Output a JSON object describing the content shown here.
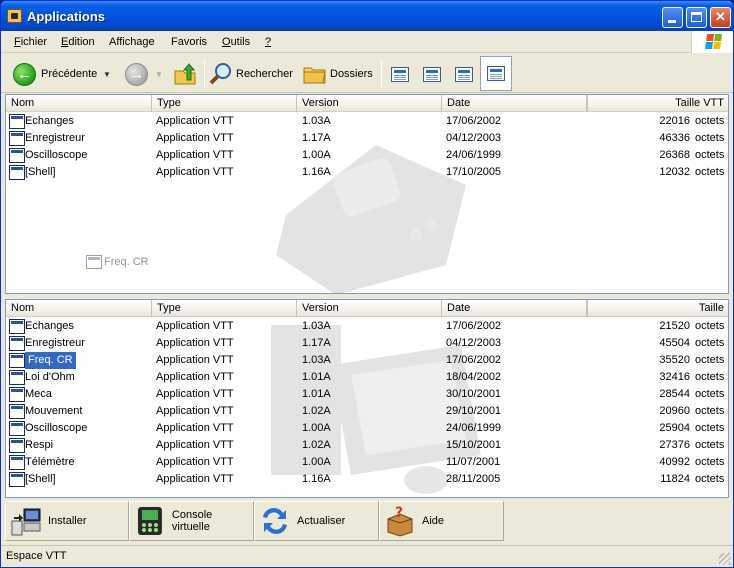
{
  "window": {
    "title": "Applications"
  },
  "menu": [
    {
      "mnemonic": "F",
      "rest": "ichier"
    },
    {
      "mnemonic": "E",
      "rest": "dition"
    },
    {
      "mnemonic": "",
      "rest": "Affichage"
    },
    {
      "mnemonic": "",
      "rest": "Favoris"
    },
    {
      "mnemonic": "O",
      "rest": "utils"
    },
    {
      "mnemonic": "?",
      "rest": ""
    }
  ],
  "menu_full": [
    "Fichier",
    "Edition",
    "Affichage",
    "Favoris",
    "Outils",
    "?"
  ],
  "toolbar": {
    "back_label": "Précédente",
    "search_label": "Rechercher",
    "folders_label": "Dossiers"
  },
  "top_pane": {
    "columns": [
      "Nom",
      "Type",
      "Version",
      "Date",
      "Taille VTT"
    ],
    "rows": [
      {
        "name": "Echanges",
        "type": "Application VTT",
        "version": "1.03A",
        "date": "17/06/2002",
        "size": "22016",
        "unit": "octets"
      },
      {
        "name": "Enregistreur",
        "type": "Application VTT",
        "version": "1.17A",
        "date": "04/12/2003",
        "size": "46336",
        "unit": "octets"
      },
      {
        "name": "Oscilloscope",
        "type": "Application VTT",
        "version": "1.00A",
        "date": "24/06/1999",
        "size": "26368",
        "unit": "octets"
      },
      {
        "name": "[Shell]",
        "type": "Application VTT",
        "version": "1.16A",
        "date": "17/10/2005",
        "size": "12032",
        "unit": "octets"
      }
    ],
    "drag_ghost_label": "Freq. CR"
  },
  "bottom_pane": {
    "columns": [
      "Nom",
      "Type",
      "Version",
      "Date",
      "Taille"
    ],
    "rows": [
      {
        "name": "Echanges",
        "type": "Application VTT",
        "version": "1.03A",
        "date": "17/06/2002",
        "size": "21520",
        "unit": "octets"
      },
      {
        "name": "Enregistreur",
        "type": "Application VTT",
        "version": "1.17A",
        "date": "04/12/2003",
        "size": "45504",
        "unit": "octets"
      },
      {
        "name": "Freq. CR",
        "type": "Application VTT",
        "version": "1.03A",
        "date": "17/06/2002",
        "size": "35520",
        "unit": "octets",
        "selected": true
      },
      {
        "name": "Loi d'Ohm",
        "type": "Application VTT",
        "version": "1.01A",
        "date": "18/04/2002",
        "size": "32416",
        "unit": "octets"
      },
      {
        "name": "Meca",
        "type": "Application VTT",
        "version": "1.01A",
        "date": "30/10/2001",
        "size": "28544",
        "unit": "octets"
      },
      {
        "name": "Mouvement",
        "type": "Application VTT",
        "version": "1.02A",
        "date": "29/10/2001",
        "size": "20960",
        "unit": "octets"
      },
      {
        "name": "Oscilloscope",
        "type": "Application VTT",
        "version": "1.00A",
        "date": "24/06/1999",
        "size": "25904",
        "unit": "octets"
      },
      {
        "name": "Respi",
        "type": "Application VTT",
        "version": "1.02A",
        "date": "15/10/2001",
        "size": "27376",
        "unit": "octets"
      },
      {
        "name": "Télémètre",
        "type": "Application VTT",
        "version": "1.00A",
        "date": "11/07/2001",
        "size": "40992",
        "unit": "octets"
      },
      {
        "name": "[Shell]",
        "type": "Application VTT",
        "version": "1.16A",
        "date": "28/11/2005",
        "size": "11824",
        "unit": "octets"
      }
    ]
  },
  "actions": [
    {
      "label": "Installer",
      "icon": "install-icon"
    },
    {
      "label": "Console virtuelle",
      "icon": "console-icon"
    },
    {
      "label": "Actualiser",
      "icon": "refresh-icon"
    },
    {
      "label": "Aide",
      "icon": "help-box-icon"
    }
  ],
  "status": {
    "text": "Espace VTT"
  },
  "colors": {
    "title_bar": "#0054e3",
    "selection": "#316ac5",
    "window_bg": "#ece9d8"
  }
}
